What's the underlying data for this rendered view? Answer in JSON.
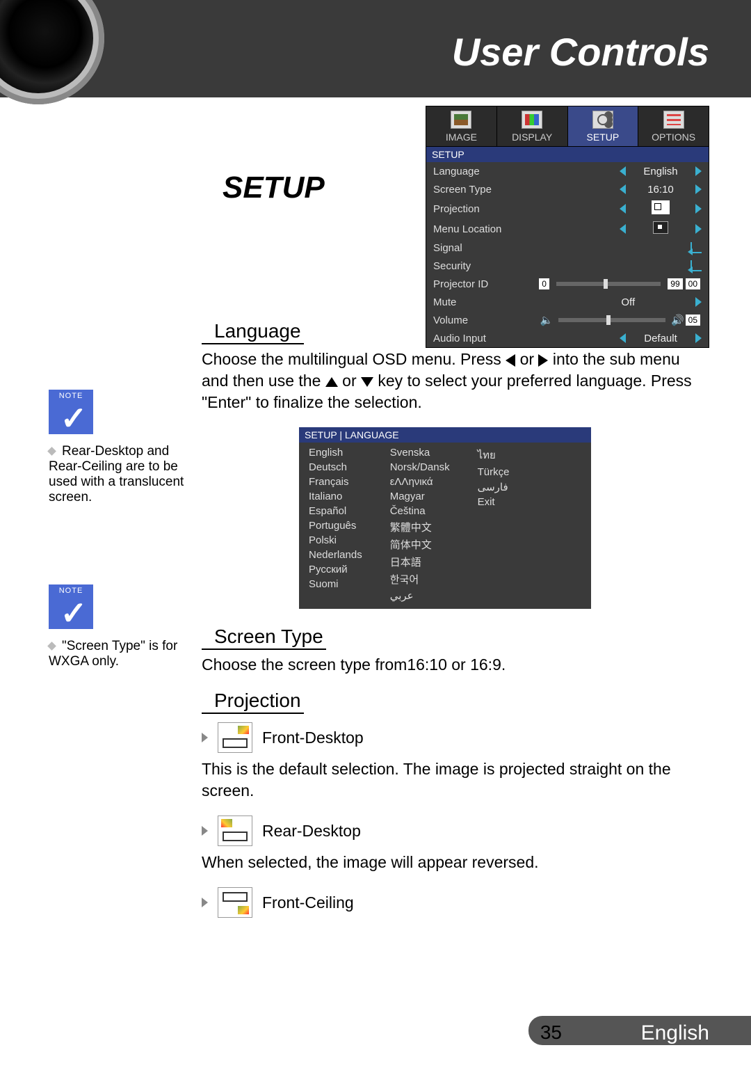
{
  "header": {
    "title": "User Controls"
  },
  "section_title": "SETUP",
  "osd": {
    "tabs": {
      "image": "IMAGE",
      "display": "DISPLAY",
      "setup": "SETUP",
      "options": "OPTIONS"
    },
    "breadcrumb": "SETUP",
    "rows": {
      "language": {
        "label": "Language",
        "value": "English"
      },
      "screen_type": {
        "label": "Screen Type",
        "value": "16:10"
      },
      "projection": {
        "label": "Projection"
      },
      "menu_location": {
        "label": "Menu Location"
      },
      "signal": {
        "label": "Signal"
      },
      "security": {
        "label": "Security"
      },
      "projector_id": {
        "label": "Projector ID",
        "min": "0",
        "max": "99",
        "value": "00"
      },
      "mute": {
        "label": "Mute",
        "value": "Off"
      },
      "volume": {
        "label": "Volume",
        "value": "05"
      },
      "audio_input": {
        "label": "Audio Input",
        "value": "Default"
      }
    }
  },
  "sections": {
    "language": {
      "heading": "Language",
      "text_a": "Choose the multilingual OSD menu. Press ",
      "text_b": " or ",
      "text_c": " into the sub menu and then use the ",
      "text_d": " or ",
      "text_e": " key to select your preferred language. Press \"Enter\" to finalize the selection."
    },
    "screen_type": {
      "heading": "Screen Type",
      "text": "Choose the screen type from16:10 or 16:9."
    },
    "projection": {
      "heading": "Projection",
      "front_desktop": {
        "label": "Front-Desktop",
        "desc": "This is the default selection. The image is projected straight on the screen."
      },
      "rear_desktop": {
        "label": "Rear-Desktop",
        "desc": "When selected, the image will appear reversed."
      },
      "front_ceiling": {
        "label": "Front-Ceiling"
      }
    }
  },
  "lang_menu": {
    "breadcrumb": "SETUP | LANGUAGE",
    "col1": [
      "English",
      "Deutsch",
      "Français",
      "Italiano",
      "Español",
      "Português",
      "Polski",
      "Nederlands",
      "Русский",
      "Suomi"
    ],
    "col2": [
      "Svenska",
      "Norsk/Dansk",
      "εΛΛηνικά",
      "Magyar",
      "Čeština",
      "繁體中文",
      "简体中文",
      "日本語",
      "한국어",
      "عربي"
    ],
    "col3": [
      "ไทย",
      "Türkçe",
      "فارسی",
      "Exit"
    ]
  },
  "notes": {
    "n1": "Rear-Desktop and Rear-Ceiling are to be used with a translucent screen.",
    "n2": "\"Screen Type\" is for WXGA only."
  },
  "footer": {
    "page": "35",
    "lang": "English"
  }
}
